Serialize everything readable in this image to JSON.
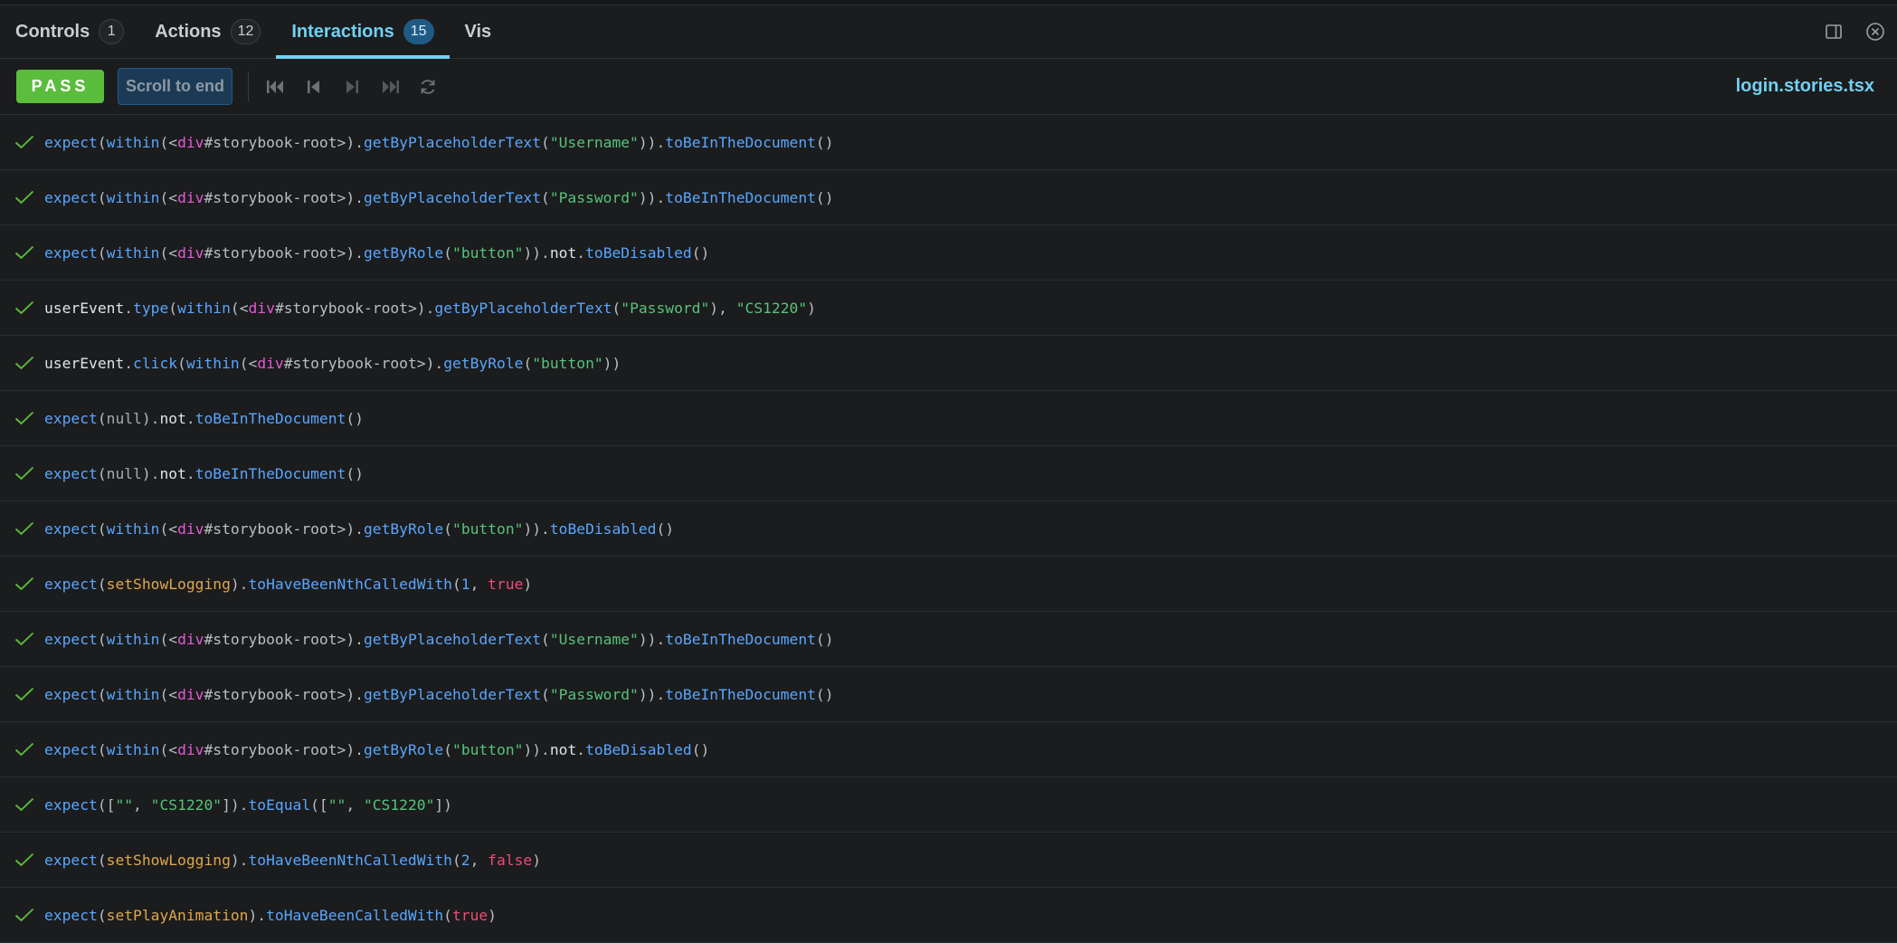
{
  "tabs": [
    {
      "label": "Controls",
      "badge": "1"
    },
    {
      "label": "Actions",
      "badge": "12"
    },
    {
      "label": "Interactions",
      "badge": "15",
      "active": true
    },
    {
      "label": "Vis"
    }
  ],
  "toolbar": {
    "status": "PASS",
    "scroll_label": "Scroll to end",
    "filename": "login.stories.tsx",
    "controls": [
      "skip-to-start-icon",
      "step-back-icon",
      "step-forward-icon",
      "skip-to-end-icon",
      "rerun-icon"
    ]
  },
  "steps": [
    [
      [
        "fn",
        "expect"
      ],
      [
        "pl",
        "("
      ],
      [
        "fn",
        "within"
      ],
      [
        "pl",
        "(<"
      ],
      [
        "tag",
        "div"
      ],
      [
        "sel",
        "#storybook-root"
      ],
      [
        "pl",
        ">)."
      ],
      [
        "fn",
        "getByPlaceholderText"
      ],
      [
        "pl",
        "("
      ],
      [
        "str",
        "\"Username\""
      ],
      [
        "pl",
        "))."
      ],
      [
        "fn",
        "toBeInTheDocument"
      ],
      [
        "pl",
        "()"
      ]
    ],
    [
      [
        "fn",
        "expect"
      ],
      [
        "pl",
        "("
      ],
      [
        "fn",
        "within"
      ],
      [
        "pl",
        "(<"
      ],
      [
        "tag",
        "div"
      ],
      [
        "sel",
        "#storybook-root"
      ],
      [
        "pl",
        ">)."
      ],
      [
        "fn",
        "getByPlaceholderText"
      ],
      [
        "pl",
        "("
      ],
      [
        "str",
        "\"Password\""
      ],
      [
        "pl",
        "))."
      ],
      [
        "fn",
        "toBeInTheDocument"
      ],
      [
        "pl",
        "()"
      ]
    ],
    [
      [
        "fn",
        "expect"
      ],
      [
        "pl",
        "("
      ],
      [
        "fn",
        "within"
      ],
      [
        "pl",
        "(<"
      ],
      [
        "tag",
        "div"
      ],
      [
        "sel",
        "#storybook-root"
      ],
      [
        "pl",
        ">)."
      ],
      [
        "fn",
        "getByRole"
      ],
      [
        "pl",
        "("
      ],
      [
        "str",
        "\"button\""
      ],
      [
        "pl",
        "))."
      ],
      [
        "kw",
        "not"
      ],
      [
        "pl",
        "."
      ],
      [
        "fn",
        "toBeDisabled"
      ],
      [
        "pl",
        "()"
      ]
    ],
    [
      [
        "kw",
        "userEvent"
      ],
      [
        "pl",
        "."
      ],
      [
        "fn",
        "type"
      ],
      [
        "pl",
        "("
      ],
      [
        "fn",
        "within"
      ],
      [
        "pl",
        "(<"
      ],
      [
        "tag",
        "div"
      ],
      [
        "sel",
        "#storybook-root"
      ],
      [
        "pl",
        ">)."
      ],
      [
        "fn",
        "getByPlaceholderText"
      ],
      [
        "pl",
        "("
      ],
      [
        "str",
        "\"Password\""
      ],
      [
        "pl",
        "), "
      ],
      [
        "str",
        "\"CS1220\""
      ],
      [
        "pl",
        ")"
      ]
    ],
    [
      [
        "kw",
        "userEvent"
      ],
      [
        "pl",
        "."
      ],
      [
        "fn",
        "click"
      ],
      [
        "pl",
        "("
      ],
      [
        "fn",
        "within"
      ],
      [
        "pl",
        "(<"
      ],
      [
        "tag",
        "div"
      ],
      [
        "sel",
        "#storybook-root"
      ],
      [
        "pl",
        ">)."
      ],
      [
        "fn",
        "getByRole"
      ],
      [
        "pl",
        "("
      ],
      [
        "str",
        "\"button\""
      ],
      [
        "pl",
        "))"
      ]
    ],
    [
      [
        "fn",
        "expect"
      ],
      [
        "pl",
        "("
      ],
      [
        "nul",
        "null"
      ],
      [
        "pl",
        ")."
      ],
      [
        "kw",
        "not"
      ],
      [
        "pl",
        "."
      ],
      [
        "fn",
        "toBeInTheDocument"
      ],
      [
        "pl",
        "()"
      ]
    ],
    [
      [
        "fn",
        "expect"
      ],
      [
        "pl",
        "("
      ],
      [
        "nul",
        "null"
      ],
      [
        "pl",
        ")."
      ],
      [
        "kw",
        "not"
      ],
      [
        "pl",
        "."
      ],
      [
        "fn",
        "toBeInTheDocument"
      ],
      [
        "pl",
        "()"
      ]
    ],
    [
      [
        "fn",
        "expect"
      ],
      [
        "pl",
        "("
      ],
      [
        "fn",
        "within"
      ],
      [
        "pl",
        "(<"
      ],
      [
        "tag",
        "div"
      ],
      [
        "sel",
        "#storybook-root"
      ],
      [
        "pl",
        ">)."
      ],
      [
        "fn",
        "getByRole"
      ],
      [
        "pl",
        "("
      ],
      [
        "str",
        "\"button\""
      ],
      [
        "pl",
        "))."
      ],
      [
        "fn",
        "toBeDisabled"
      ],
      [
        "pl",
        "()"
      ]
    ],
    [
      [
        "fn",
        "expect"
      ],
      [
        "pl",
        "("
      ],
      [
        "id",
        "setShowLogging"
      ],
      [
        "pl",
        ")."
      ],
      [
        "fn",
        "toHaveBeenNthCalledWith"
      ],
      [
        "pl",
        "("
      ],
      [
        "num",
        "1"
      ],
      [
        "pl",
        ", "
      ],
      [
        "bool",
        "true"
      ],
      [
        "pl",
        ")"
      ]
    ],
    [
      [
        "fn",
        "expect"
      ],
      [
        "pl",
        "("
      ],
      [
        "fn",
        "within"
      ],
      [
        "pl",
        "(<"
      ],
      [
        "tag",
        "div"
      ],
      [
        "sel",
        "#storybook-root"
      ],
      [
        "pl",
        ">)."
      ],
      [
        "fn",
        "getByPlaceholderText"
      ],
      [
        "pl",
        "("
      ],
      [
        "str",
        "\"Username\""
      ],
      [
        "pl",
        "))."
      ],
      [
        "fn",
        "toBeInTheDocument"
      ],
      [
        "pl",
        "()"
      ]
    ],
    [
      [
        "fn",
        "expect"
      ],
      [
        "pl",
        "("
      ],
      [
        "fn",
        "within"
      ],
      [
        "pl",
        "(<"
      ],
      [
        "tag",
        "div"
      ],
      [
        "sel",
        "#storybook-root"
      ],
      [
        "pl",
        ">)."
      ],
      [
        "fn",
        "getByPlaceholderText"
      ],
      [
        "pl",
        "("
      ],
      [
        "str",
        "\"Password\""
      ],
      [
        "pl",
        "))."
      ],
      [
        "fn",
        "toBeInTheDocument"
      ],
      [
        "pl",
        "()"
      ]
    ],
    [
      [
        "fn",
        "expect"
      ],
      [
        "pl",
        "("
      ],
      [
        "fn",
        "within"
      ],
      [
        "pl",
        "(<"
      ],
      [
        "tag",
        "div"
      ],
      [
        "sel",
        "#storybook-root"
      ],
      [
        "pl",
        ">)."
      ],
      [
        "fn",
        "getByRole"
      ],
      [
        "pl",
        "("
      ],
      [
        "str",
        "\"button\""
      ],
      [
        "pl",
        "))."
      ],
      [
        "kw",
        "not"
      ],
      [
        "pl",
        "."
      ],
      [
        "fn",
        "toBeDisabled"
      ],
      [
        "pl",
        "()"
      ]
    ],
    [
      [
        "fn",
        "expect"
      ],
      [
        "pl",
        "(["
      ],
      [
        "str",
        "\"\""
      ],
      [
        "pl",
        ", "
      ],
      [
        "str",
        "\"CS1220\""
      ],
      [
        "pl",
        "])."
      ],
      [
        "fn",
        "toEqual"
      ],
      [
        "pl",
        "(["
      ],
      [
        "str",
        "\"\""
      ],
      [
        "pl",
        ", "
      ],
      [
        "str",
        "\"CS1220\""
      ],
      [
        "pl",
        "])"
      ]
    ],
    [
      [
        "fn",
        "expect"
      ],
      [
        "pl",
        "("
      ],
      [
        "id",
        "setShowLogging"
      ],
      [
        "pl",
        ")."
      ],
      [
        "fn",
        "toHaveBeenNthCalledWith"
      ],
      [
        "pl",
        "("
      ],
      [
        "num",
        "2"
      ],
      [
        "pl",
        ", "
      ],
      [
        "bool",
        "false"
      ],
      [
        "pl",
        ")"
      ]
    ],
    [
      [
        "fn",
        "expect"
      ],
      [
        "pl",
        "("
      ],
      [
        "id",
        "setPlayAnimation"
      ],
      [
        "pl",
        ")."
      ],
      [
        "fn",
        "toHaveBeenCalledWith"
      ],
      [
        "pl",
        "("
      ],
      [
        "bool",
        "true"
      ],
      [
        "pl",
        ")"
      ]
    ]
  ]
}
